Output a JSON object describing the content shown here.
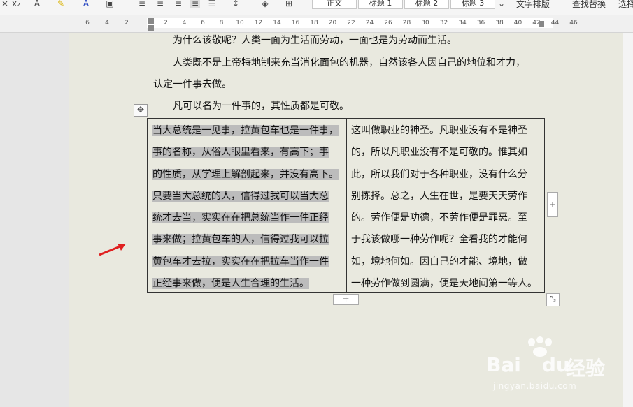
{
  "toolbar": {
    "styles": [
      "正文",
      "标题 1",
      "标题 2",
      "标题 3"
    ],
    "text_layout_label": "文字排版",
    "find_replace_label": "查找替换",
    "select_label": "选择",
    "icons": [
      "close-icon",
      "subscript-icon",
      "text-effects-icon",
      "highlight-icon",
      "font-color-icon",
      "char-border-icon",
      "align-left-icon",
      "align-center-icon",
      "align-right-icon",
      "justify-icon",
      "distributed-icon",
      "line-spacing-icon",
      "shading-icon",
      "borders-icon"
    ]
  },
  "ruler": {
    "left_ticks": [
      "6",
      "4",
      "2"
    ],
    "right_ticks": [
      "2",
      "4",
      "6",
      "8",
      "10",
      "12",
      "14",
      "16",
      "18",
      "20",
      "22",
      "24",
      "26",
      "28",
      "30",
      "32",
      "34",
      "36",
      "38",
      "40",
      "42",
      "44",
      "46"
    ]
  },
  "document": {
    "paragraphs": [
      "为什么该敬呢？人类一面为生活而劳动，一面也是为劳动而生活。",
      "人类既不是上帝特地制来充当消化面包的机器，自然该各人因自己的地位和才力，",
      "认定一件事去做。",
      "凡可以名为一件事的，其性质都是可敬。"
    ],
    "table": {
      "left_lines": [
        "当大总统是一见事，拉黄包车也是一件事，",
        "事的名称，从俗人眼里看来，有高下；事",
        "的性质，从学理上解剖起来，并没有高下。",
        "只要当大总统的人，信得过我可以当大总",
        "统才去当，实实在在把总统当作一件正经",
        "事来做；拉黄包车的人，信得过我可以拉",
        "黄包车才去拉，实实在在把拉车当作一件",
        "正经事来做，便是人生合理的生活。"
      ],
      "right_lines": [
        "这叫做职业的神圣。凡职业没有不是神圣",
        "的，所以凡职业没有不是可敬的。惟其如",
        "此，所以我们对于各种职业，没有什么分",
        "别拣择。总之，人生在世，是要天天劳作",
        "的。劳作便是功德，不劳作便是罪恶。至",
        "于我该做哪一种劳作呢？全看我的才能何",
        "如，境地何如。因自己的才能、境地，做",
        "一种劳作做到圆满，便是天地间第一等人。"
      ],
      "add_symbol": "+"
    }
  },
  "watermark": {
    "logo": "Bai",
    "logo_du": "du",
    "text": "经验",
    "url": "jingyan.baidu.com"
  },
  "colors": {
    "page": "#e9e9df",
    "selection": "#bcbcbc",
    "arrow": "#e02020"
  }
}
